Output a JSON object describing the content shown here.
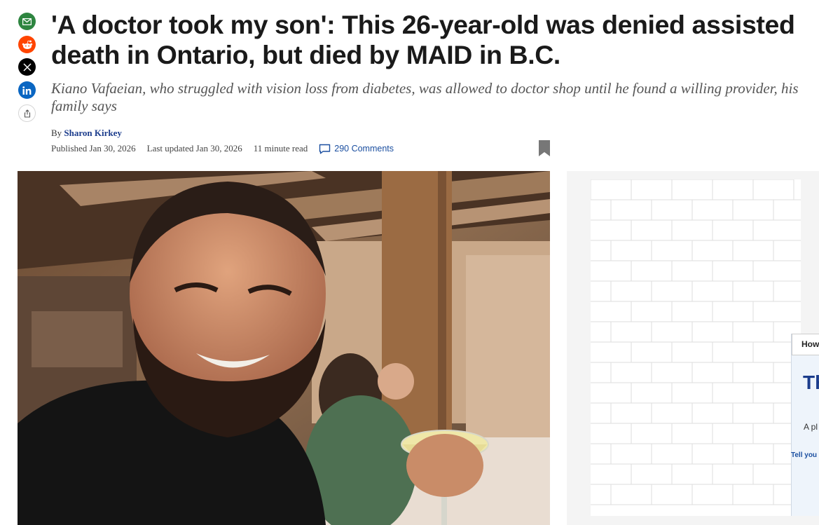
{
  "article": {
    "headline": "'A doctor took my son': This 26-year-old was denied assisted death in Ontario, but died by MAID in B.C.",
    "deck": "Kiano Vafaeian, who struggled with vision loss from diabetes, was allowed to doctor shop until he found a willing provider, his family says",
    "byline_prefix": "By",
    "author": "Sharon Kirkey",
    "published": "Published Jan 30, 2026",
    "updated": "Last updated Jan 30, 2026",
    "read_time": "11 minute read",
    "comments": "290 Comments"
  },
  "share": {
    "icons": [
      "email-icon",
      "reddit-icon",
      "x-icon",
      "linkedin-icon",
      "share-icon"
    ],
    "colors": {
      "email": "#2e8540",
      "reddit": "#ff4500",
      "x": "#000000",
      "linkedin": "#0a66c2"
    }
  },
  "ad": {
    "question": "How",
    "headline": "Th",
    "body": "A pl",
    "link": "Tell you"
  },
  "colors": {
    "link": "#1b3c8c",
    "comments": "#1b4fa0",
    "headline": "#1a1a1a"
  }
}
